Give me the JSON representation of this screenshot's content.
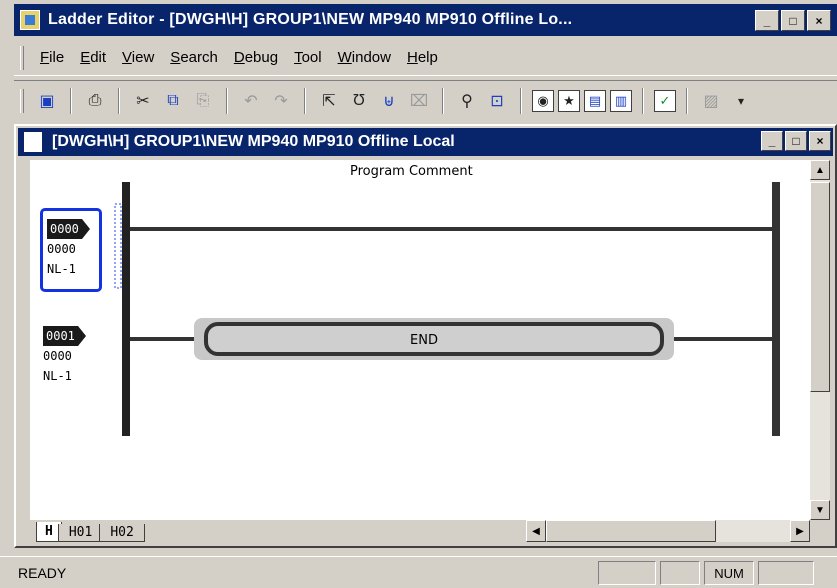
{
  "app": {
    "title": "Ladder Editor - [DWGH\\H]     GROUP1\\NEW  MP940  MP910       Offline  Lo...",
    "window_buttons": {
      "minimize": "_",
      "maximize": "□",
      "close": "×"
    }
  },
  "menu": [
    "File",
    "Edit",
    "View",
    "Search",
    "Debug",
    "Tool",
    "Window",
    "Help"
  ],
  "toolbar": {
    "icons": [
      "save-icon",
      "print-icon",
      "cut-icon",
      "copy-icon",
      "paste-icon",
      "undo-icon",
      "redo-icon",
      "select-pointer-icon",
      "contact-icon",
      "coil-icon",
      "delete-connection-icon",
      "find-icon",
      "zoom-icon",
      "monitor-icon",
      "star-icon",
      "register-list-icon",
      "crossref-icon",
      "checkbox-icon",
      "disabled-icon",
      "dropdown-icon"
    ],
    "glyphs": [
      "▣",
      "⎙",
      "✂",
      "⧉",
      "⎘",
      "↶",
      "↷",
      "⇱",
      "Ʊ",
      "⊎",
      "⌧",
      "⚲",
      "⊡",
      "◉",
      "★",
      "▤",
      "▥",
      "✓",
      "▨",
      "▾"
    ]
  },
  "child": {
    "title": "[DWGH\\H]     GROUP1\\NEW  MP940  MP910       Offline  Local",
    "window_buttons": {
      "minimize": "_",
      "maximize": "□",
      "close": "×"
    }
  },
  "ladder": {
    "program_comment": "Program Comment",
    "rungs": [
      {
        "step": "0000",
        "line2": "0000",
        "line3": "NL-1",
        "selected": true
      },
      {
        "step": "0001",
        "line2": "0000",
        "line3": "NL-1",
        "selected": false
      }
    ],
    "end_label": "END"
  },
  "scrollbars": {
    "up": "▲",
    "down": "▼",
    "left": "◀",
    "right": "▶"
  },
  "sheet_tabs": [
    "H",
    "H01",
    "H02"
  ],
  "status": {
    "text": "READY",
    "panels": [
      "",
      "",
      "NUM",
      ""
    ]
  }
}
